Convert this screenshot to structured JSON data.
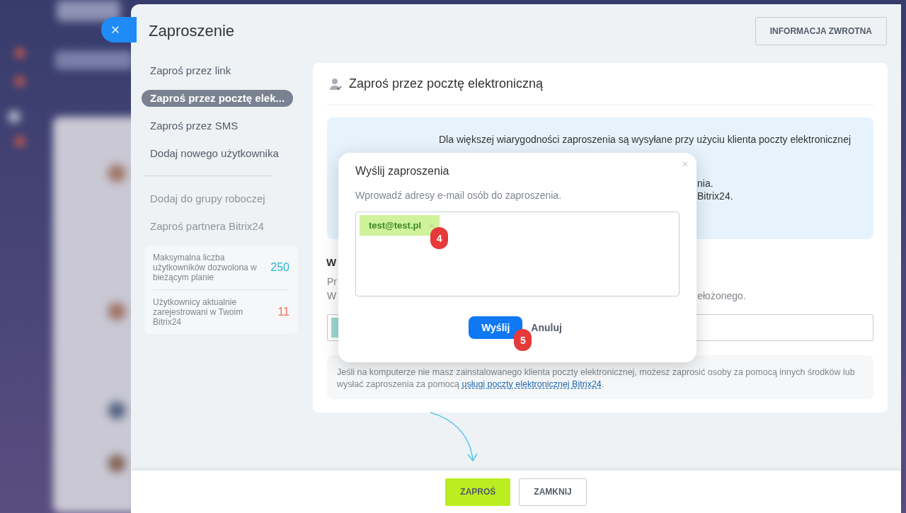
{
  "title": "Zaproszenie",
  "feedback_button": "INFORMACJA ZWROTNA",
  "nav": {
    "items": [
      {
        "label": "Zaproś przez link",
        "selected": false
      },
      {
        "label": "Zaproś przez pocztę elek...",
        "selected": true
      },
      {
        "label": "Zaproś przez SMS",
        "selected": false
      },
      {
        "label": "Dodaj nowego użytkownika",
        "selected": false
      }
    ],
    "secondary_items": [
      "Dodaj do grupy roboczej",
      "Zaproś partnera Bitrix24"
    ],
    "stats": [
      {
        "label": "Maksymalna liczba użytkowników dozwolona w bieżącym planie",
        "value": "250",
        "color": "#2ab3d6"
      },
      {
        "label": "Użytkownicy aktualnie zarejestrowani w Twoim Bitrix24",
        "value": "11",
        "color": "#f0735f"
      }
    ]
  },
  "card": {
    "title": "Zaproś przez pocztę elektroniczną",
    "info": {
      "line": "Dla większej wiarygodności zaproszenia są wysyłane przy użyciu klienta poczty elektronicznej",
      "fragments": [
        "nia.",
        "Bitrix24."
      ]
    },
    "section": {
      "heading": "W",
      "lines": [
        "Pr",
        "W"
      ],
      "line_tail": "ełożonego."
    },
    "note": {
      "text": "Jeśli na komputerze nie masz zainstalowanego klienta poczty elektronicznej, możesz zaprosić osoby za pomocą innych środków lub wysłać zaproszenia za pomocą ",
      "link": "usługi poczty elektronicznej Bitrix24",
      "end": "."
    }
  },
  "modal": {
    "title": "Wyślij zaproszenia",
    "hint": "Wprowadź adresy e-mail osób do zaproszenia.",
    "tags": [
      {
        "label": "test@test.pl",
        "step": "4"
      }
    ],
    "send": {
      "label": "Wyślij",
      "step": "5"
    },
    "cancel": "Anuluj"
  },
  "footer": {
    "buttons": [
      {
        "label": "ZAPROŚ",
        "kind": "primary"
      },
      {
        "label": "ZAMKNIJ",
        "kind": "secondary"
      }
    ]
  }
}
